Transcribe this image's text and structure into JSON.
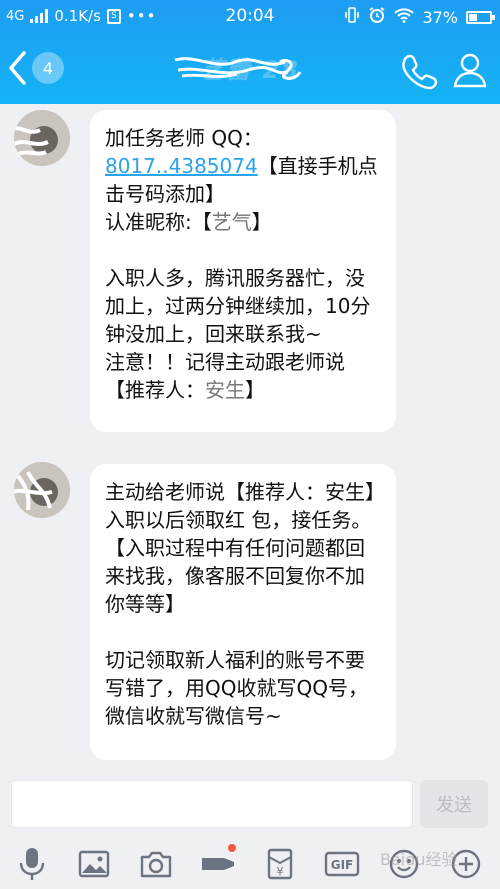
{
  "status_bar": {
    "network": "4G",
    "speed": "0.1K/s",
    "time": "20:04",
    "battery": "37%"
  },
  "header": {
    "unread_count": "4",
    "contact_name": "艺蕾 28"
  },
  "messages": [
    {
      "lines_a": "加任务老师 QQ：",
      "qq_number": "8017..4385074",
      "lines_b": "【直接手机点击号码添加】",
      "lines_c": "认准昵称:【",
      "nick_obscured": "艺气",
      "lines_d": "】",
      "para2": "入职人多，腾讯服务器忙，没加上，过两分钟继续加，10分钟没加上，回来联系我~",
      "para3": "注意！！记得主动跟老师说【推荐人：",
      "referrer_obscured": "安生",
      "para3_end": "】"
    },
    {
      "para1": "主动给老师说【推荐人：安生】入职以后领取红 包，接任务。",
      "para2": "【入职过程中有任何问题都回来找我，像客服不回复你不加你等等】",
      "para3": "切记领取新人福利的账号不要写错了，用QQ收就写QQ号，微信收就写微信号~"
    }
  ],
  "input": {
    "send_label": "发送"
  },
  "toolbar_icons": [
    "microphone-icon",
    "image-icon",
    "camera-icon",
    "voice-changer-icon",
    "red-packet-icon",
    "gif-icon",
    "emoji-icon",
    "plus-icon"
  ],
  "watermark": "Baidu经验",
  "colors": {
    "header": "#1ea5f3",
    "link": "#2aa3ef",
    "background": "#eef0f3"
  }
}
